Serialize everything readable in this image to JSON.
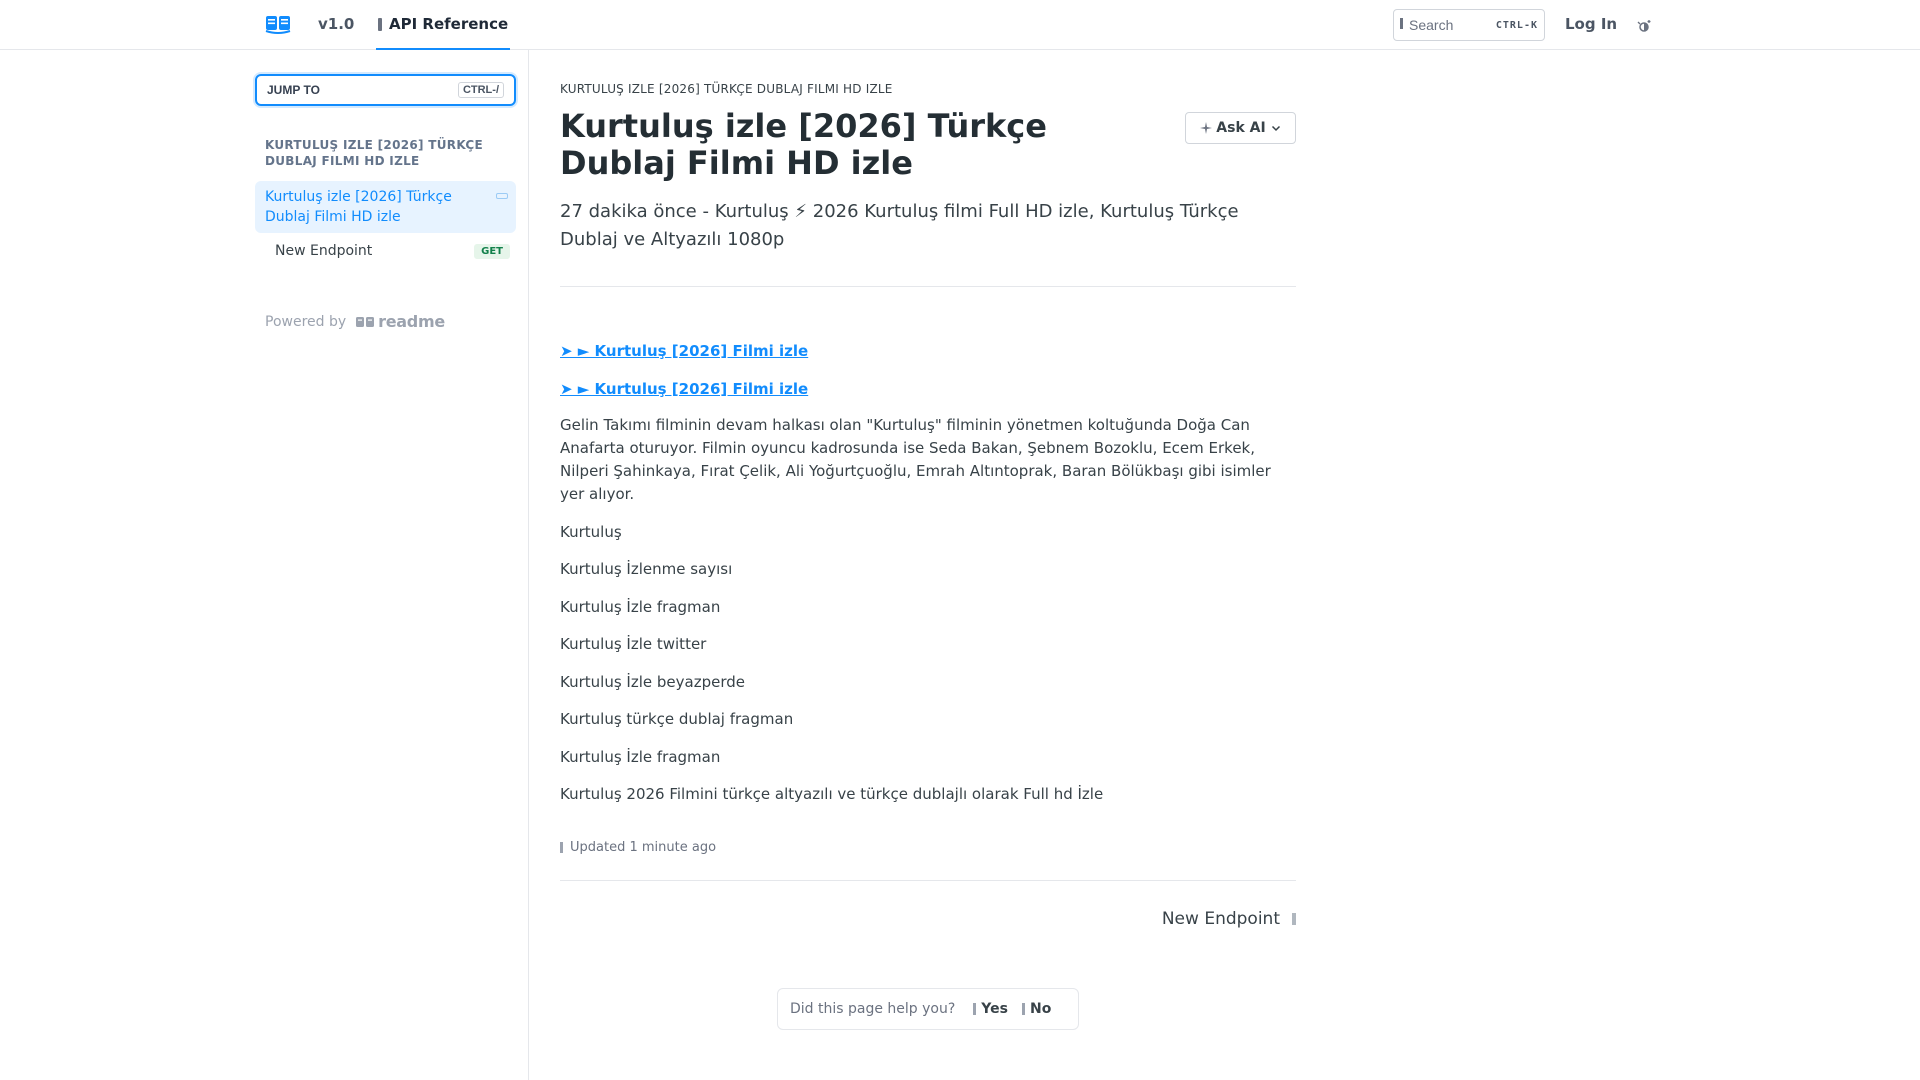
{
  "header": {
    "version": "v1.0",
    "api_tab": "API Reference",
    "search_label": "Search",
    "search_shortcut": "CTRL-K",
    "login": "Log In"
  },
  "sidebar": {
    "jump_label": "JUMP TO",
    "jump_shortcut": "CTRL-/",
    "section_title": "KURTULUŞ IZLE [2026] TÜRKÇE DUBLAJ FILMI HD IZLE",
    "active_item": "Kurtuluş izle [2026] Türkçe Dublaj Filmi HD izle",
    "item": "New Endpoint",
    "item_badge": "GET",
    "powered_by": "Powered by",
    "readme": "readme"
  },
  "main": {
    "breadcrumb": "KURTULUŞ IZLE [2026] TÜRKÇE DUBLAJ FILMI HD IZLE",
    "title": "Kurtuluş izle [2026] Türkçe Dublaj Filmi HD izle",
    "ask_ai": "Ask AI",
    "excerpt": "27 dakika önce - Kurtuluş ⚡ 2026 Kurtuluş filmi Full HD izle, Kurtuluş Türkçe Dublaj ve Altyazılı 1080p",
    "link1": "➤ ► Kurtuluş [2026] Filmi izle",
    "link2": "➤ ► Kurtuluş [2026] Filmi izle",
    "paragraph": "Gelin Takımı filminin devam halkası olan \"Kurtuluş\" filminin yönetmen koltuğunda Doğa Can Anafarta oturuyor. Filmin oyuncu kadrosunda ise Seda Bakan, Şebnem Bozoklu, Ecem Erkek, Nilperi Şahinkaya, Fırat Çelik, Ali Yoğurtçuoğlu, Emrah Altıntoprak, Baran Bölükbaşı gibi isimler yer alıyor.",
    "lines": [
      "Kurtuluş",
      "Kurtuluş İzlenme sayısı",
      "Kurtuluş İzle fragman",
      "Kurtuluş İzle twitter",
      "Kurtuluş İzle beyazperde",
      "Kurtuluş türkçe dublaj fragman",
      "Kurtuluş İzle fragman",
      "Kurtuluş 2026 Filmini türkçe altyazılı ve türkçe dublajlı olarak Full hd İzle"
    ],
    "updated": "Updated 1 minute ago",
    "next": "New Endpoint",
    "feedback_question": "Did this page help you?",
    "yes": "Yes",
    "no": "No"
  },
  "colors": {
    "accent": "#118cfd",
    "badge_bg": "#e6f5ea",
    "badge_text": "#12804b",
    "active_bg": "#e7f3ff"
  },
  "icons": [
    "readme-logo-icon",
    "api-reference-icon",
    "search-icon",
    "theme-toggle-icon",
    "collapse-icon",
    "sparkle-icon",
    "chevron-down-icon",
    "clock-icon",
    "arrow-right-icon",
    "thumbs-up-icon",
    "thumbs-down-icon"
  ]
}
